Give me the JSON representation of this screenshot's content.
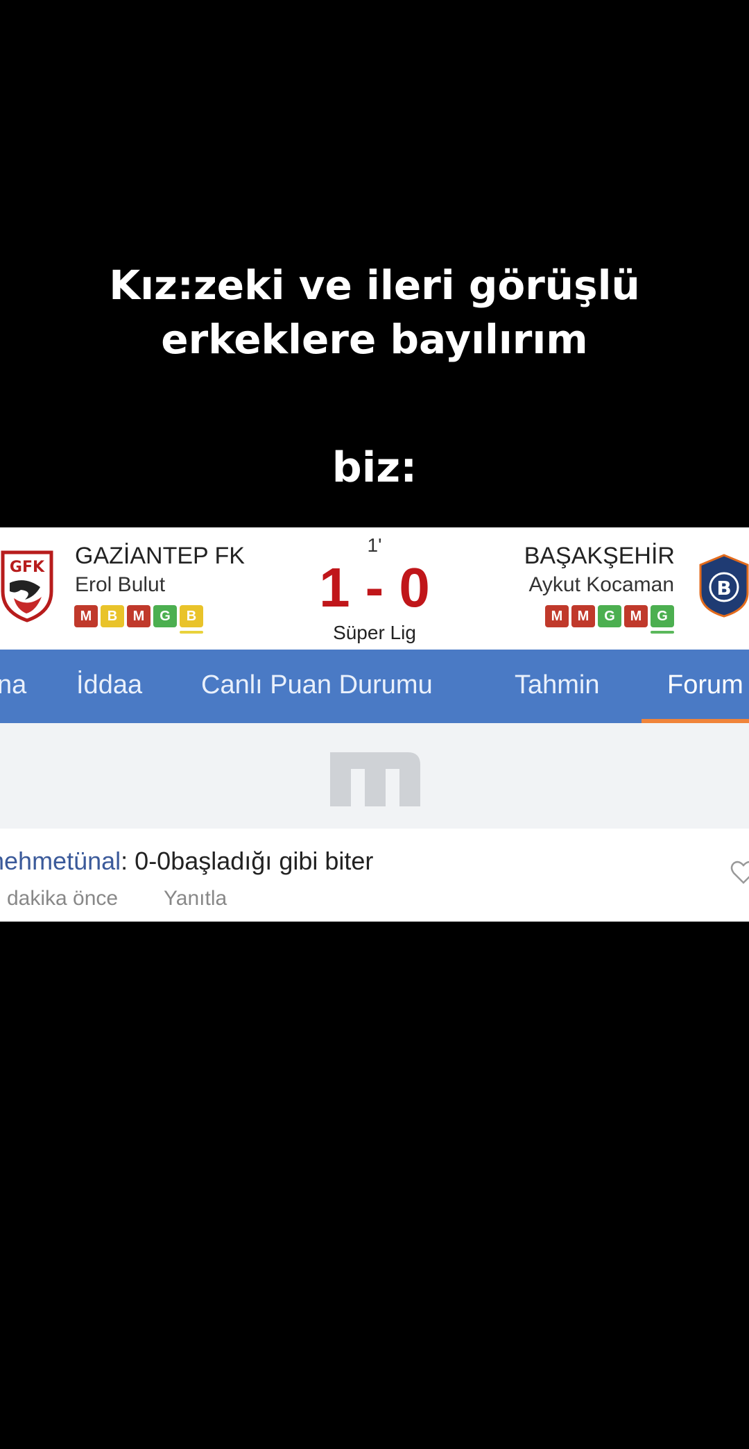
{
  "caption": {
    "line1": "Kız:zeki ve ileri görüşlü",
    "line2": "erkeklere bayılırım",
    "line3": "biz:"
  },
  "match": {
    "home": {
      "logo_text": "GFK",
      "name": "GAZİANTEP FK",
      "coach": "Erol Bulut",
      "form": [
        "M",
        "B",
        "M",
        "G",
        "B"
      ]
    },
    "away": {
      "logo_text": "B",
      "name": "BAŞAKŞEHİR",
      "coach": "Aykut Kocaman",
      "form": [
        "M",
        "M",
        "G",
        "M",
        "G"
      ]
    },
    "minute": "1'",
    "home_score": "1",
    "score_separator": "-",
    "away_score": "0",
    "league": "Süper Lig"
  },
  "tabs": [
    {
      "label": "na",
      "active": false
    },
    {
      "label": "İddaa",
      "active": false
    },
    {
      "label": "Canlı Puan Durumu",
      "active": false
    },
    {
      "label": "Tahmin",
      "active": false
    },
    {
      "label": "Forum",
      "active": true
    }
  ],
  "comment": {
    "user": "nehmetünal",
    "separator": ":",
    "text": "0-0başladığı gibi biter",
    "time": "dakika önce",
    "reply_label": "Yanıtla"
  },
  "colors": {
    "form_M": "#c0392b",
    "form_B": "#e9c32a",
    "form_G": "#4caf50",
    "tab_bar": "#4a7ac5",
    "tab_underline": "#f0843a",
    "score": "#c0161a",
    "username": "#3b5a9a"
  },
  "icons": {
    "home_logo": "gaziantep-fk-crest",
    "away_logo": "basaksehir-crest",
    "brand": "mackolik-m-logo",
    "like": "heart-outline-icon"
  }
}
